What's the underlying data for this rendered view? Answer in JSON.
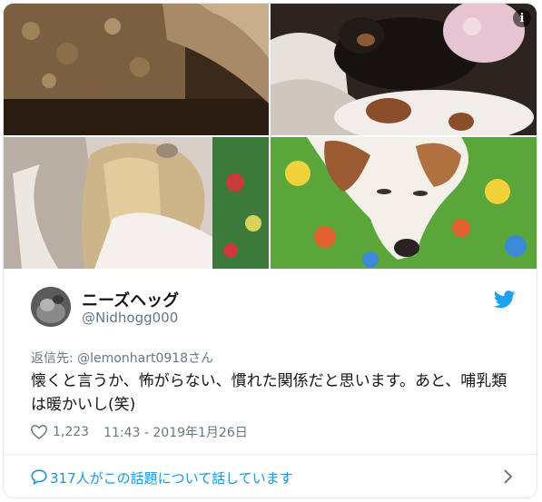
{
  "tweet": {
    "display_name": "ニーズヘッグ",
    "handle": "@Nidhogg000",
    "reply_to": "返信先: @lemonhart0918さん",
    "text": "懐くと言うか、怖がらない、慣れた関係だと思います。あと、哺乳類は暖かいし(笑)",
    "likes": "1,223",
    "timestamp": "11:43 - 2019年1月26日",
    "conversation": "317人がこの話題について話しています",
    "info_badge": "i"
  },
  "colors": {
    "twitter_blue": "#1da1f2",
    "link_blue": "#1b95e0",
    "secondary_text": "#657786",
    "primary_text": "#14171a"
  },
  "icons": {
    "twitter": "twitter-bird-logo",
    "like": "heart-outline",
    "conversation": "speech-bubble",
    "expand": "chevron-right"
  }
}
